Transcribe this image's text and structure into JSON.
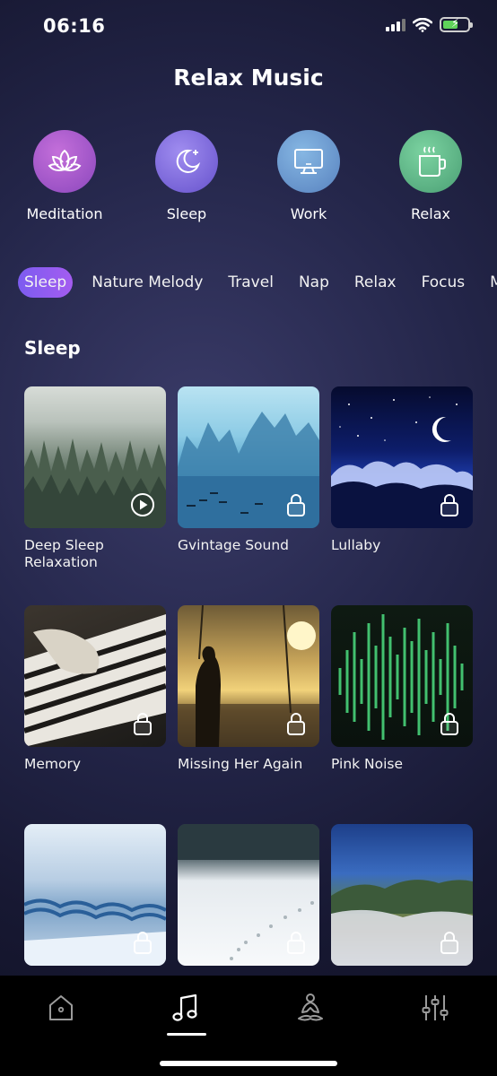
{
  "status": {
    "time": "06:16"
  },
  "app_title": "Relax Music",
  "categories": [
    {
      "label": "Meditation",
      "icon": "lotus-icon",
      "color_from": "#c06ad6",
      "color_to": "#8e4bc0"
    },
    {
      "label": "Sleep",
      "icon": "moon-icon",
      "color_from": "#9a86ee",
      "color_to": "#6a58cf"
    },
    {
      "label": "Work",
      "icon": "monitor-icon",
      "color_from": "#7fb0df",
      "color_to": "#5b86c2"
    },
    {
      "label": "Relax",
      "icon": "coffee-cup-icon",
      "color_from": "#74cc9a",
      "color_to": "#4ea479"
    }
  ],
  "tabs": [
    "Sleep",
    "Nature Melody",
    "Travel",
    "Nap",
    "Relax",
    "Focus",
    "Mo"
  ],
  "active_tab": "Sleep",
  "section_title": "Sleep",
  "tracks": [
    {
      "title": "Deep Sleep Relaxation",
      "badge": "play-icon"
    },
    {
      "title": "Gvintage Sound",
      "badge": "lock-icon"
    },
    {
      "title": "Lullaby",
      "badge": "lock-icon"
    },
    {
      "title": "Memory",
      "badge": "lock-icon"
    },
    {
      "title": "Missing Her Again",
      "badge": "lock-icon"
    },
    {
      "title": "Pink Noise",
      "badge": "lock-icon"
    },
    {
      "title": "",
      "badge": "lock-icon"
    },
    {
      "title": "",
      "badge": "lock-icon"
    },
    {
      "title": "",
      "badge": "lock-icon"
    }
  ],
  "tab_bar": [
    "home-icon",
    "music-note-icon",
    "meditation-icon",
    "equalizer-icon"
  ],
  "colors": {
    "accent_from": "#7c5cf0",
    "accent_to": "#a45cf0",
    "battery": "#5fd35a"
  }
}
